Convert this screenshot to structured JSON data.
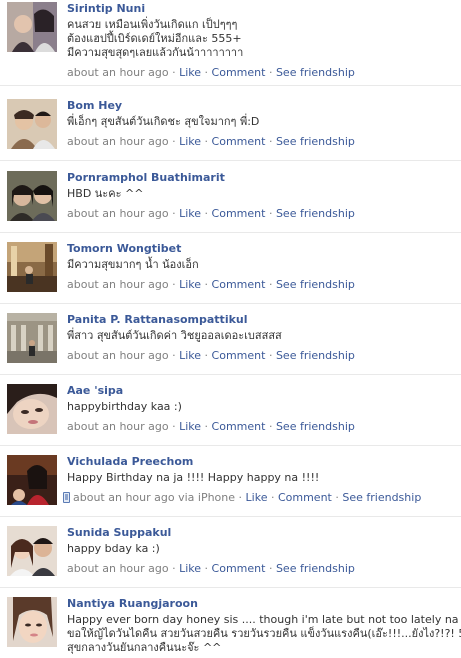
{
  "meta": {
    "time": "about an hour ago",
    "via_iphone": "via iPhone",
    "like": "Like",
    "comment": "Comment",
    "see_friendship": "See friendship",
    "separator": "·"
  },
  "colors": {
    "link": "#3b5998",
    "meta": "#808080",
    "text": "#333333",
    "divider": "#e9e9e9"
  },
  "posts": [
    {
      "name": "Sirintip Nuni",
      "lines": [
        "คนสวย เหมือนเพิ่งวันเกิดแก เป็ปๆๆๆ",
        "ต้องแฮปปี้เบิร์ดเดย์ใหม่อีกและ 555+",
        "มีความสุขสุดๆเลยแล้วกันน้าาาาาาาา"
      ]
    },
    {
      "name": "Bom Hey",
      "lines": [
        "พี่เอ็กๆ สุขสันต์วันเกิดชะ สุขใจมากๆ พี่:D"
      ]
    },
    {
      "name": "Pornramphol Buathimarit",
      "lines": [
        "HBD นะคะ ^^"
      ]
    },
    {
      "name": "Tomorn Wongtibet",
      "lines": [
        "มีความสุขมากๆ น้ำ น้องเอ็ก"
      ]
    },
    {
      "name": "Panita P. Rattanasompattikul",
      "lines": [
        "พี่สาว สุขสันต์วันเกิดค่า วิชยูออลเดอะเบสสสส"
      ]
    },
    {
      "name": "Aae 'sipa",
      "lines": [
        "happybirthday kaa :)"
      ]
    },
    {
      "name": "Vichulada Preechom",
      "lines": [
        "Happy Birthday na ja !!!! Happy happy na !!!!"
      ],
      "iphone": true
    },
    {
      "name": "Sunida Suppakul",
      "lines": [
        "happy bday ka :)"
      ]
    },
    {
      "name": "Nantiya Ruangjaroon",
      "lines": [
        "Happy ever born day honey sis .... though i'm late but not too lately na",
        "ขอให้ญ้ไดวันไดคืน สวยวันสวยคืน รวยวันรวยคืน แข็งวันแรงคืน(เอ๊ะ!!!...ยังไง?!?! 555)",
        "สุขกลางวันยันกลางคืนนะจ๊ะ ^^"
      ]
    }
  ]
}
